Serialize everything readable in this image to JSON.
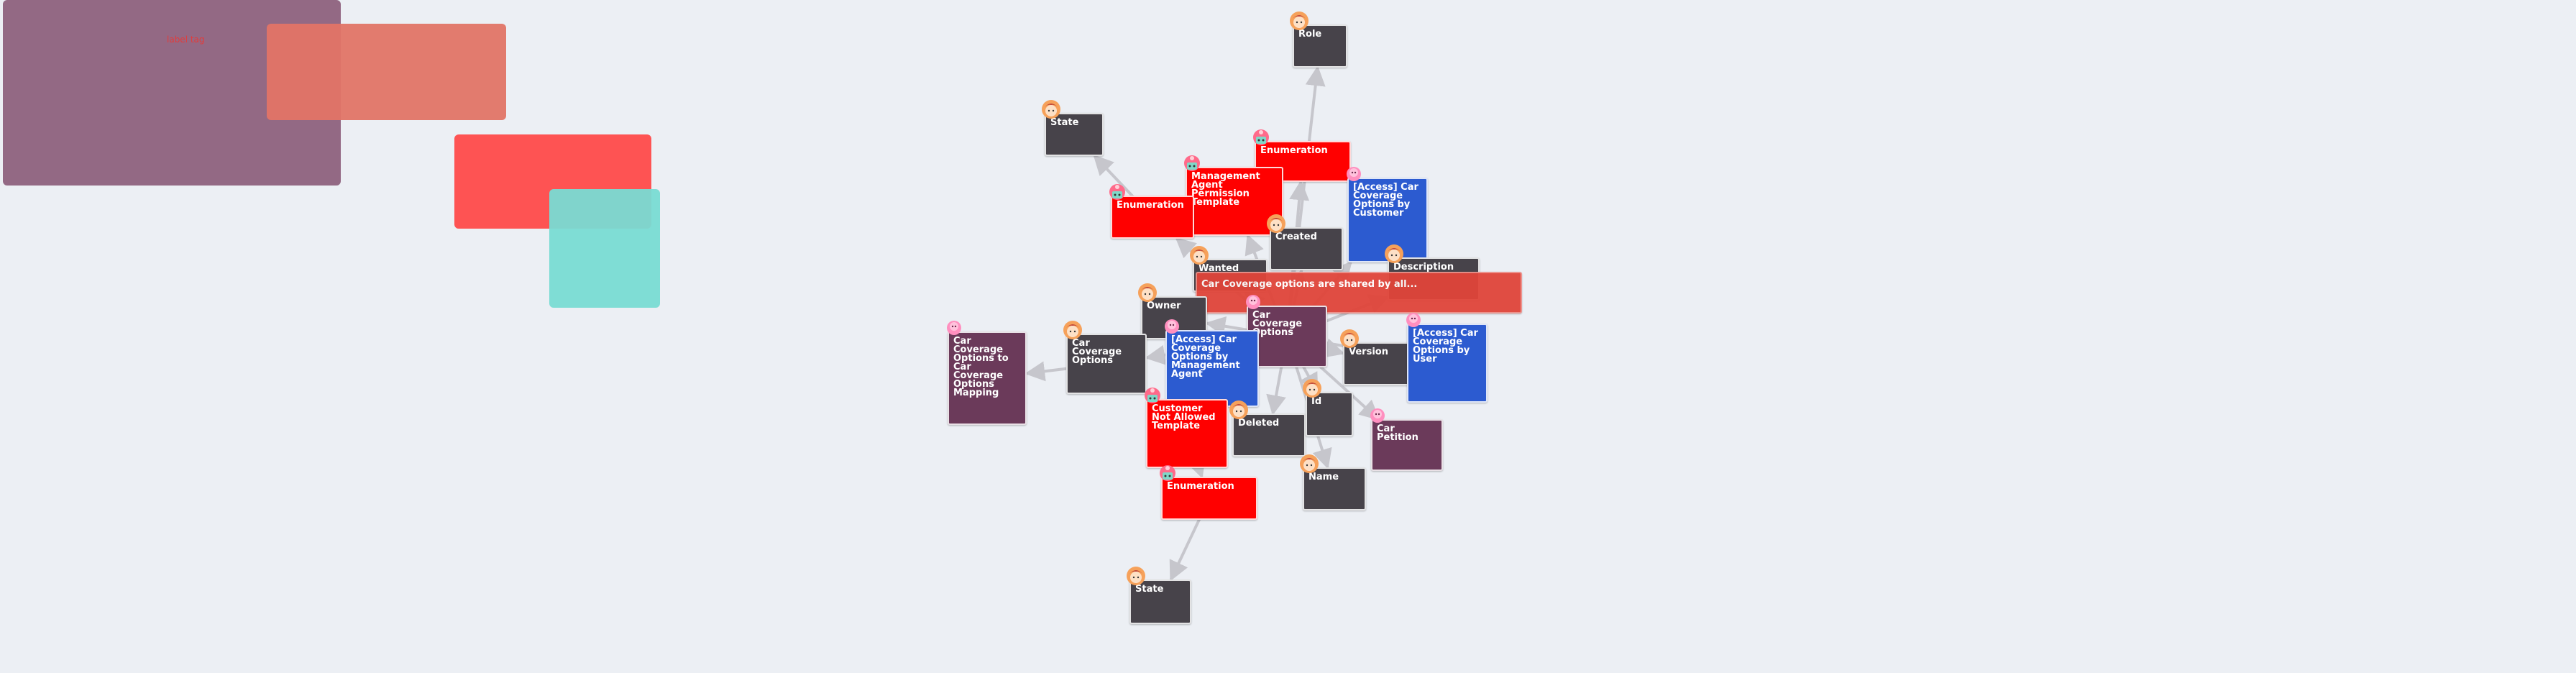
{
  "colors": {
    "background": "#eceff4",
    "role": "#47434a",
    "enumeration": "#ff0000",
    "entity": "#6b3a5a",
    "access": "#2c5bd0",
    "template": "#ff0000",
    "edge": "#c6c6cc",
    "edge_accent": "#f2a0b0"
  },
  "regions": [
    {
      "id": "r1",
      "color": "#8a5a78",
      "opacity": 0.9,
      "label": ""
    },
    {
      "id": "r2",
      "color": "#e27466",
      "opacity": 0.95,
      "label": ""
    },
    {
      "id": "r3",
      "color": "#ff4a4a",
      "opacity": 0.95,
      "label": ""
    },
    {
      "id": "r4",
      "color": "#79dbd3",
      "opacity": 0.95,
      "label": ""
    }
  ],
  "region_label": "label tag",
  "nodes": [
    {
      "id": "role",
      "label": "Role",
      "kind": "role",
      "badge": "avatar-icon"
    },
    {
      "id": "state-top",
      "label": "State",
      "kind": "role",
      "badge": "avatar-icon"
    },
    {
      "id": "enum-top-right",
      "label": "Enumeration",
      "kind": "enumeration",
      "badge": "robot-icon"
    },
    {
      "id": "mgmt-template",
      "label": "Management Agent Permission Template",
      "kind": "template",
      "badge": "robot-icon"
    },
    {
      "id": "enum-left",
      "label": "Enumeration",
      "kind": "enumeration",
      "badge": "robot-icon"
    },
    {
      "id": "access-customer",
      "label": "[Access] Car Coverage Options by Customer",
      "kind": "access",
      "badge": "pink-blob-icon"
    },
    {
      "id": "created",
      "label": "Created",
      "kind": "role",
      "badge": "avatar-icon"
    },
    {
      "id": "wanted",
      "label": "Wanted",
      "kind": "role",
      "badge": "avatar-icon"
    },
    {
      "id": "description",
      "label": "Description",
      "kind": "role",
      "badge": "avatar-icon"
    },
    {
      "id": "shared-banner",
      "label": "Car Coverage options are shared by all...",
      "kind": "template",
      "badge": ""
    },
    {
      "id": "owner",
      "label": "Owner",
      "kind": "role",
      "badge": "avatar-icon"
    },
    {
      "id": "car-coverage-options-center",
      "label": "Car Coverage Options",
      "kind": "entity",
      "badge": "pink-blob-icon"
    },
    {
      "id": "car-coverage-options",
      "label": "Car Coverage Options",
      "kind": "role",
      "badge": "avatar-icon"
    },
    {
      "id": "mapping",
      "label": "Car Coverage Options to Car Coverage Options Mapping",
      "kind": "entity",
      "badge": "pink-blob-icon"
    },
    {
      "id": "access-mgmt",
      "label": "[Access] Car Coverage Options by Management Agent",
      "kind": "access",
      "badge": "pink-blob-icon"
    },
    {
      "id": "version",
      "label": "Version",
      "kind": "role",
      "badge": "avatar-icon"
    },
    {
      "id": "access-user",
      "label": "[Access] Car Coverage Options by User",
      "kind": "access",
      "badge": "pink-blob-icon"
    },
    {
      "id": "customer-not-allowed",
      "label": "Customer Not Allowed Template",
      "kind": "template",
      "badge": "robot-icon"
    },
    {
      "id": "deleted",
      "label": "Deleted",
      "kind": "role",
      "badge": "avatar-icon"
    },
    {
      "id": "id",
      "label": "Id",
      "kind": "role",
      "badge": "avatar-icon"
    },
    {
      "id": "car-petition",
      "label": "Car Petition",
      "kind": "entity",
      "badge": "pink-blob-icon"
    },
    {
      "id": "enum-bottom",
      "label": "Enumeration",
      "kind": "enumeration",
      "badge": "robot-icon"
    },
    {
      "id": "name",
      "label": "Name",
      "kind": "role",
      "badge": "avatar-icon"
    },
    {
      "id": "state-bottom",
      "label": "State",
      "kind": "role",
      "badge": "avatar-icon"
    }
  ],
  "edges": [
    {
      "from": "car-coverage-options-center",
      "to": "role"
    },
    {
      "from": "enum-left",
      "to": "state-top"
    },
    {
      "from": "car-coverage-options-center",
      "to": "enum-top-right"
    },
    {
      "from": "car-coverage-options-center",
      "to": "mgmt-template"
    },
    {
      "from": "car-coverage-options-center",
      "to": "enum-left"
    },
    {
      "from": "car-coverage-options-center",
      "to": "access-customer"
    },
    {
      "from": "car-coverage-options-center",
      "to": "created"
    },
    {
      "from": "car-coverage-options-center",
      "to": "wanted"
    },
    {
      "from": "car-coverage-options-center",
      "to": "description"
    },
    {
      "from": "car-coverage-options-center",
      "to": "owner"
    },
    {
      "from": "car-coverage-options-center",
      "to": "car-coverage-options"
    },
    {
      "from": "car-coverage-options",
      "to": "mapping"
    },
    {
      "from": "car-coverage-options-center",
      "to": "access-mgmt"
    },
    {
      "from": "car-coverage-options-center",
      "to": "version"
    },
    {
      "from": "car-coverage-options-center",
      "to": "access-user"
    },
    {
      "from": "car-coverage-options-center",
      "to": "customer-not-allowed"
    },
    {
      "from": "car-coverage-options-center",
      "to": "deleted"
    },
    {
      "from": "car-coverage-options-center",
      "to": "id"
    },
    {
      "from": "car-coverage-options-center",
      "to": "car-petition"
    },
    {
      "from": "customer-not-allowed",
      "to": "enum-bottom"
    },
    {
      "from": "car-coverage-options-center",
      "to": "name"
    },
    {
      "from": "enum-bottom",
      "to": "state-bottom"
    }
  ]
}
